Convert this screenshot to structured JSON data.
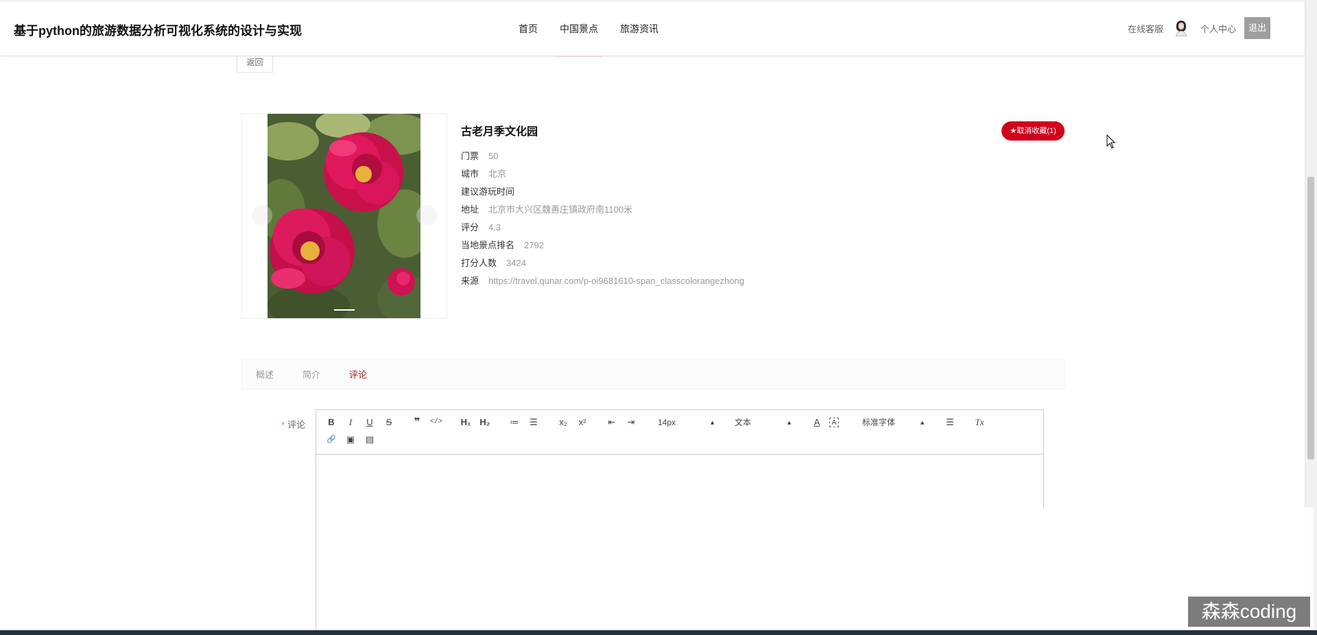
{
  "header": {
    "site_title": "基于python的旅游数据分析可视化系统的设计与实现",
    "nav": [
      {
        "label": "首页"
      },
      {
        "label": "中国景点"
      },
      {
        "label": "旅游资讯"
      }
    ],
    "online_service": "在线客服",
    "user_center": "个人中心",
    "logout": "退出"
  },
  "back_label": "返回",
  "spot": {
    "name": "古老月季文化园",
    "favorite_label": "★取消收藏(1)",
    "fields": [
      {
        "label": "门票",
        "value": "50"
      },
      {
        "label": "城市",
        "value": "北京"
      },
      {
        "label": "建议游玩时间",
        "value": ""
      },
      {
        "label": "地址",
        "value": "北京市大兴区魏善庄镇政府南1100米"
      },
      {
        "label": "评分",
        "value": "4.3"
      },
      {
        "label": "当地景点排名",
        "value": "2792"
      },
      {
        "label": "打分人数",
        "value": "3424"
      },
      {
        "label": "来源",
        "value": "https://travel.qunar.com/p-oi9681610-span_classcolorangezhong"
      }
    ]
  },
  "tabs": [
    {
      "label": "概述",
      "active": false
    },
    {
      "label": "简介",
      "active": false
    },
    {
      "label": "评论",
      "active": true
    }
  ],
  "comment": {
    "required_mark": "*",
    "label": "评论",
    "toolbar": {
      "bold": "B",
      "italic": "I",
      "underline": "U",
      "strike": "S",
      "blockquote": "❞",
      "code": "</>",
      "h1": "H₁",
      "h2": "H₂",
      "ordered_list": "≔",
      "bullet_list": "☰",
      "subscript": "x₂",
      "superscript": "x²",
      "outdent": "⇤",
      "indent": "⇥",
      "size": "14px",
      "header": "文本",
      "color": "A",
      "background": "A",
      "font": "标准字体",
      "align": "☰",
      "clean": "Tx",
      "link": "🔗",
      "image": "▣",
      "video": "▤"
    },
    "content": ""
  },
  "watermark": "森森coding",
  "colors": {
    "accent_red": "#d0021b",
    "active_tab": "#b0181d",
    "logout_bg": "#9e9e9e"
  }
}
